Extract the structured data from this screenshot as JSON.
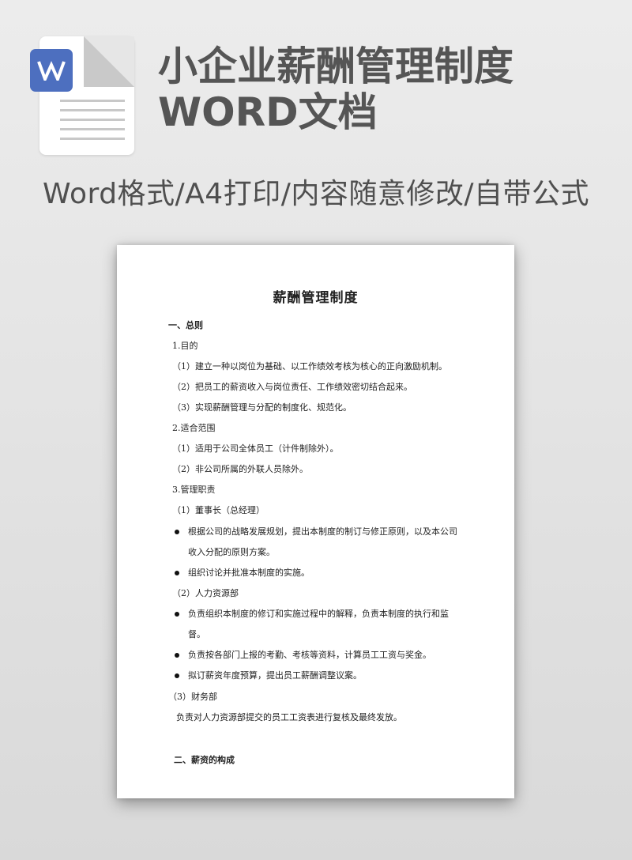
{
  "banner": {
    "title_line1": "小企业薪酬管理制度",
    "title_line2": "WORD文档",
    "subtitle": "Word格式/A4打印/内容随意修改/自带公式",
    "icon": "word-file-icon",
    "accent": "#4d6fbf"
  },
  "document": {
    "title": "薪酬管理制度",
    "lines": [
      {
        "text": "一、总则",
        "bold": true
      },
      {
        "text": "1.目的"
      },
      {
        "text": "（1）建立一种以岗位为基础、以工作绩效考核为核心的正向激励机制。"
      },
      {
        "text": "（2）把员工的薪资收入与岗位责任、工作绩效密切结合起来。"
      },
      {
        "text": "（3）实现薪酬管理与分配的制度化、规范化。"
      },
      {
        "text": "2.适合范围"
      },
      {
        "text": "（1）适用于公司全体员工（计件制除外）。"
      },
      {
        "text": "（2）非公司所属的外联人员除外。"
      },
      {
        "text": "3.管理职责"
      },
      {
        "text": "（1）董事长（总经理）"
      },
      {
        "text": "根据公司的战略发展规划，提出本制度的制订与修正原则，以及本公司",
        "bullet": true
      },
      {
        "text": "收入分配的原则方案。"
      },
      {
        "text": "组织讨论并批准本制度的实施。",
        "bullet": true
      },
      {
        "text": "（2）人力资源部"
      },
      {
        "text": "负责组织本制度的修订和实施过程中的解释，负责本制度的执行和监",
        "bullet": true
      },
      {
        "text": "督。"
      },
      {
        "text": "负责按各部门上报的考勤、考核等资料，计算员工工资与奖金。",
        "bullet": true
      },
      {
        "text": "拟订薪资年度预算，提出员工薪酬调整议案。",
        "bullet": true
      },
      {
        "text": "（3）财务部"
      },
      {
        "text": "负责对人力资源部提交的员工工资表进行复核及最终发放。"
      },
      {
        "text": "二、薪资的构成",
        "bold": true
      }
    ]
  }
}
